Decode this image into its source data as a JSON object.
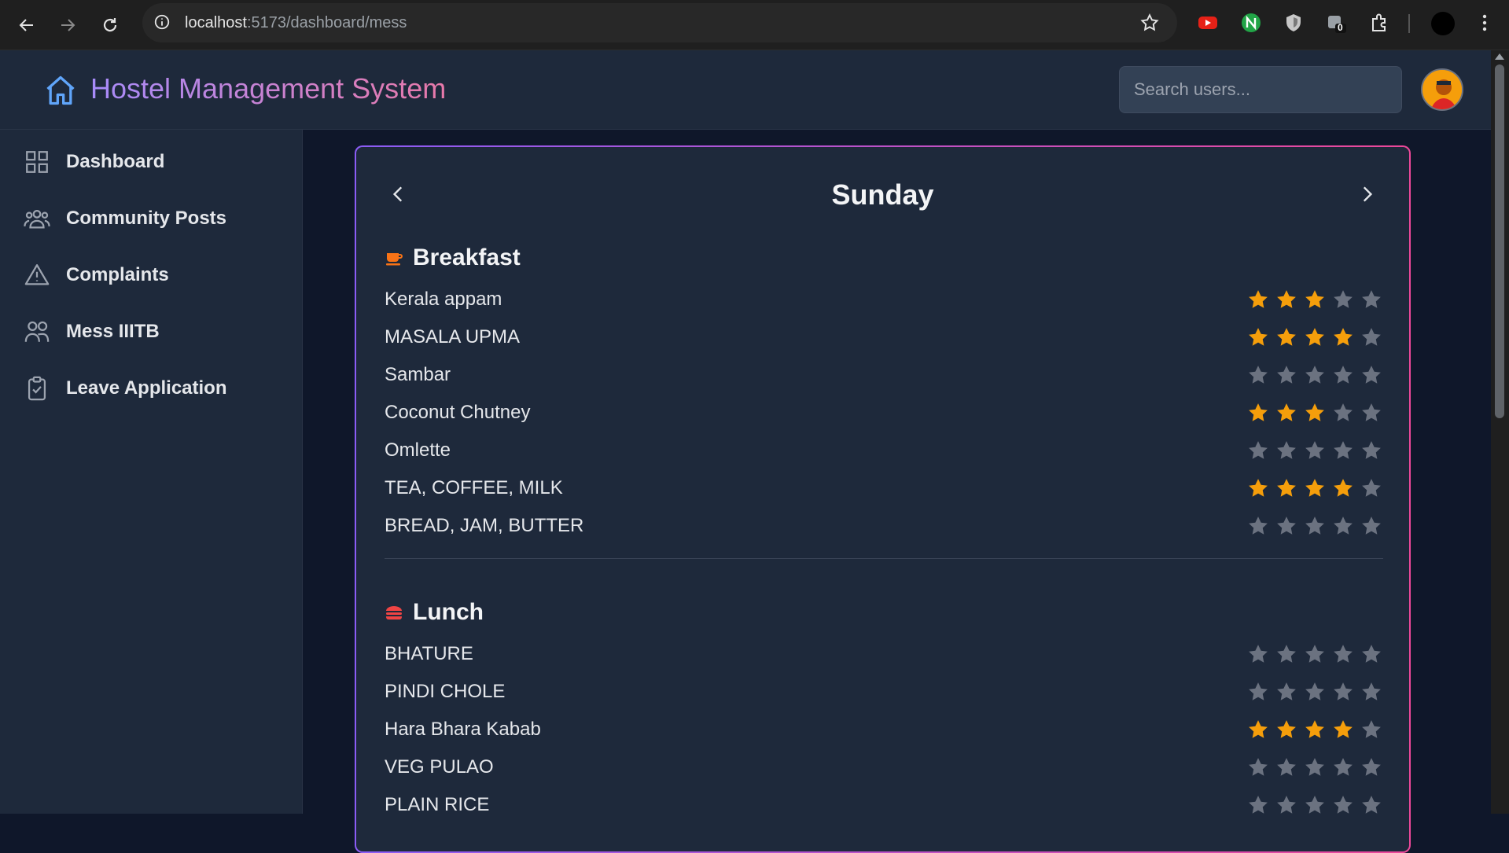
{
  "browser": {
    "url_host": "localhost",
    "url_path": ":5173/dashboard/mess",
    "extension_badge": "0"
  },
  "header": {
    "title": "Hostel Management System",
    "search_placeholder": "Search users..."
  },
  "sidebar": {
    "items": [
      {
        "label": "Dashboard",
        "icon": "grid-icon"
      },
      {
        "label": "Community Posts",
        "icon": "users-icon"
      },
      {
        "label": "Complaints",
        "icon": "warning-icon"
      },
      {
        "label": "Mess IIITB",
        "icon": "people-icon"
      },
      {
        "label": "Leave Application",
        "icon": "clipboard-check-icon"
      }
    ]
  },
  "menu": {
    "day": "Sunday",
    "meals": [
      {
        "title": "Breakfast",
        "icon": "coffee-icon",
        "items": [
          {
            "name": "Kerala appam",
            "rating": 3
          },
          {
            "name": "MASALA UPMA",
            "rating": 4
          },
          {
            "name": "Sambar",
            "rating": 0
          },
          {
            "name": "Coconut Chutney",
            "rating": 3
          },
          {
            "name": "Omlette",
            "rating": 0
          },
          {
            "name": "TEA, COFFEE, MILK",
            "rating": 4
          },
          {
            "name": "BREAD, JAM, BUTTER",
            "rating": 0
          }
        ]
      },
      {
        "title": "Lunch",
        "icon": "burger-icon",
        "items": [
          {
            "name": "BHATURE",
            "rating": 0
          },
          {
            "name": "PINDI CHOLE",
            "rating": 0
          },
          {
            "name": "Hara Bhara Kabab",
            "rating": 4
          },
          {
            "name": "VEG PULAO",
            "rating": 0
          },
          {
            "name": "PLAIN RICE",
            "rating": 0
          }
        ]
      }
    ]
  },
  "colors": {
    "star_filled": "#f59e0b",
    "star_empty": "#6b7280",
    "accent_start": "#a78bfa",
    "accent_end": "#ec4899"
  }
}
